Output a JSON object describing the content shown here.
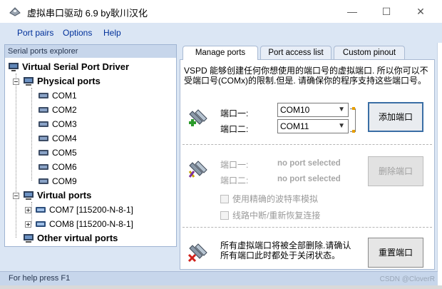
{
  "window": {
    "title": "虚拟串口驱动 6.9 by耿川汉化",
    "min_symbol": "—",
    "max_symbol": "☐",
    "close_symbol": "✕"
  },
  "menu": {
    "items": [
      "Port pairs",
      "Options",
      "Help"
    ]
  },
  "explorer": {
    "title": "Serial ports explorer",
    "root": "Virtual Serial Port Driver",
    "physical_group": "Physical ports",
    "physical_ports": [
      "COM1",
      "COM2",
      "COM3",
      "COM4",
      "COM5",
      "COM6",
      "COM9"
    ],
    "virtual_group": "Virtual ports",
    "virtual_ports": [
      "COM7 [115200-N-8-1]",
      "COM8 [115200-N-8-1]"
    ],
    "other_group": "Other virtual ports"
  },
  "tabs": [
    {
      "label": "Manage ports",
      "active": true
    },
    {
      "label": "Port access list",
      "active": false
    },
    {
      "label": "Custom pinout",
      "active": false
    }
  ],
  "manage": {
    "description": "VSPD 能够创建任何你想使用的端口号的虚拟端口. 所以你可以不受端口号(COMx)的限制.但是. 请确保你的程序支持这些端口号。",
    "add": {
      "port1_label": "端口一:",
      "port2_label": "端口二:",
      "port1_value": "COM10",
      "port2_value": "COM11",
      "button": "添加端口"
    },
    "delete": {
      "port1_label": "端口一:",
      "port2_label": "端口二:",
      "port1_value": "no port selected",
      "port2_value": "no port selected",
      "button": "删除端口",
      "check_baud": "使用精确的波特率模拟",
      "check_line": "线路中断/重新恢复连接"
    },
    "reset": {
      "text": "所有虚拟端口将被全部删除.请确认所有端口此时都处于关闭状态。",
      "button": "重置端口"
    }
  },
  "status": {
    "text": "For help press F1"
  },
  "watermark": "CSDN @CloverR",
  "colors": {
    "menu_text": "#00309a",
    "accent_link": "#e9a000"
  }
}
